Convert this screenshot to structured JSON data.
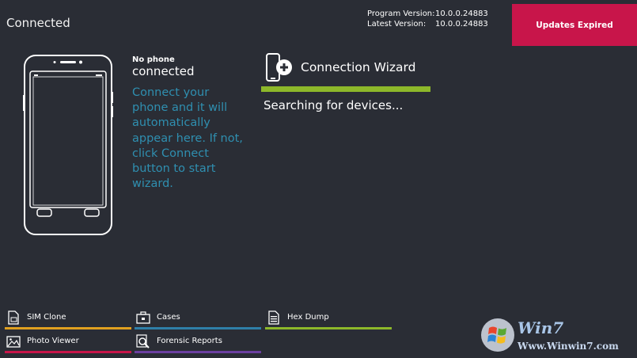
{
  "header": {
    "status_title": "Connected",
    "program_version_label": "Program Version:",
    "program_version_value": "10.0.0.24883",
    "latest_version_label": "Latest Version:",
    "latest_version_value": "10.0.0.24883",
    "updates_button": "Updates Expired"
  },
  "device": {
    "line1": "No phone",
    "line2": "connected",
    "instructions": "Connect your phone and it will automatically appear here. If not, click Connect button to start wizard."
  },
  "wizard": {
    "label": "Connection Wizard",
    "searching": "Searching for devices..."
  },
  "tools": [
    {
      "label": "SIM Clone",
      "icon": "sim-card-icon",
      "color": "#e0a020"
    },
    {
      "label": "Cases",
      "icon": "briefcase-icon",
      "color": "#2f7fa8"
    },
    {
      "label": "Hex Dump",
      "icon": "binary-file-icon",
      "color": "#8db82a"
    },
    {
      "label": "Photo Viewer",
      "icon": "photo-icon",
      "color": "#c8154a"
    },
    {
      "label": "Forensic Reports",
      "icon": "magnifier-report-icon",
      "color": "#6b3fa0"
    }
  ],
  "watermark": {
    "brand": "Win7",
    "url": "Www.Winwin7.com"
  },
  "colors": {
    "background": "#2a2d35",
    "accent_red": "#c8154a",
    "accent_green": "#8db82a",
    "instruction_blue": "#2f8fb0"
  }
}
